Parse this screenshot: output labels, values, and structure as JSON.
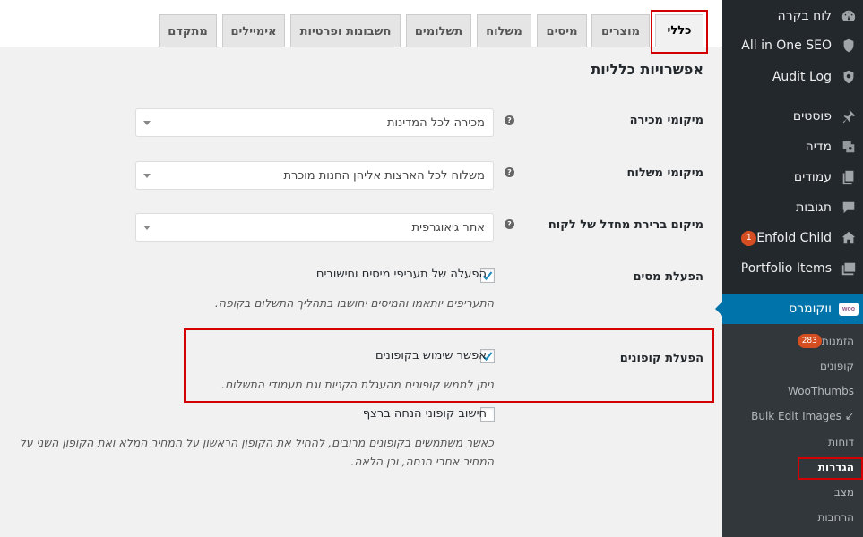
{
  "tabs": [
    "כללי",
    "מוצרים",
    "מיסים",
    "משלוח",
    "תשלומים",
    "חשבונות ופרטיות",
    "אימיילים",
    "מתקדם"
  ],
  "heading": "אפשרויות כלליות",
  "settings": {
    "selling_location": {
      "label": "מיקומי מכירה",
      "value": "מכירה לכל המדינות"
    },
    "shipping_location": {
      "label": "מיקומי משלוח",
      "value": "משלוח לכל הארצות אליהן החנות מוכרת"
    },
    "default_customer_location": {
      "label": "מיקום ברירת מחדל של לקוח",
      "value": "אתר גיאוגרפית"
    },
    "enable_taxes": {
      "label": "הפעלת מסים",
      "checkbox_label": "הפעלה של תעריפי מיסים וחישובים",
      "checked": true,
      "description": "התעריפים יותאמו והמיסים יחושבו בתהליך התשלום בקופה."
    },
    "enable_coupons": {
      "label": "הפעלת קופונים",
      "checkbox_label": "אפשר שימוש בקופונים",
      "checked": true,
      "description": "ניתן לממש קופונים מהעגלת הקניות וגם מעמודי התשלום."
    },
    "sequential_coupons": {
      "checkbox_label": "חישוב קופוני הנחה ברצף",
      "checked": false,
      "description": "כאשר משתמשים בקופונים מרובים, להחיל את הקופון הראשון על המחיר המלא ואת הקופון השני על המחיר אחרי הנחה, וכן הלאה."
    }
  },
  "sidebar": {
    "menu": [
      {
        "label": "לוח בקרה",
        "icon": "dashboard-icon"
      },
      {
        "label": "All in One SEO",
        "icon": "shield-icon"
      },
      {
        "label": "Audit Log",
        "icon": "audit-log-icon"
      },
      {
        "label": "פוסטים",
        "icon": "pin-icon"
      },
      {
        "label": "מדיה",
        "icon": "media-icon"
      },
      {
        "label": "עמודים",
        "icon": "pages-icon"
      },
      {
        "label": "תגובות",
        "icon": "comments-icon"
      },
      {
        "label": "Enfold Child",
        "icon": "home-icon",
        "badge": "1"
      },
      {
        "label": "Portfolio Items",
        "icon": "portfolio-icon"
      },
      {
        "label": "ווקומרס",
        "icon": "woocommerce-icon",
        "icon_text": "woo",
        "current": true
      }
    ],
    "submenu": [
      {
        "label": "הזמנות",
        "badge": "283"
      },
      {
        "label": "קופונים"
      },
      {
        "label": "WooThumbs"
      },
      {
        "label": "Bulk Edit Images",
        "prefix": "↙"
      },
      {
        "label": "דוחות"
      },
      {
        "label": "הגדרות",
        "active": true
      },
      {
        "label": "מצב"
      },
      {
        "label": "הרחבות"
      }
    ]
  },
  "colors": {
    "sidebar_bg": "#23282d",
    "submenu_bg": "#32373c",
    "current_menu": "#0073aa",
    "badge": "#d54e21",
    "highlight_box": "#d20000"
  }
}
